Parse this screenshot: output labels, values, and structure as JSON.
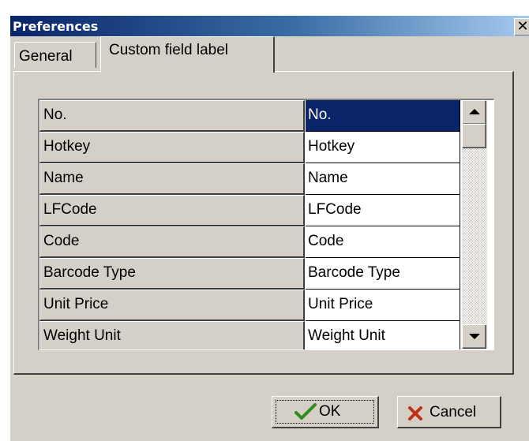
{
  "window": {
    "title": "Preferences",
    "close_glyph": "✕"
  },
  "tabs": [
    {
      "label": "General",
      "active": false
    },
    {
      "label": "Custom field label",
      "active": true
    }
  ],
  "grid": {
    "rows": [
      {
        "label": "No.",
        "value": "No."
      },
      {
        "label": "Hotkey",
        "value": "Hotkey"
      },
      {
        "label": "Name",
        "value": "Name"
      },
      {
        "label": "LFCode",
        "value": "LFCode"
      },
      {
        "label": "Code",
        "value": "Code"
      },
      {
        "label": "Barcode Type",
        "value": "Barcode Type"
      },
      {
        "label": "Unit Price",
        "value": "Unit Price"
      },
      {
        "label": "Weight Unit",
        "value": "Weight Unit"
      }
    ],
    "selected_index": 0
  },
  "buttons": {
    "ok_label": "OK",
    "cancel_label": "Cancel"
  },
  "icons": {
    "check": "check-icon",
    "cancel": "x-icon",
    "scroll_up": "arrow-up-icon",
    "scroll_down": "arrow-down-icon"
  },
  "colors": {
    "selection": "#0a246a",
    "face": "#d4d0c8",
    "ok_check": "#2e8b1f",
    "cancel_x": "#c0301a"
  }
}
